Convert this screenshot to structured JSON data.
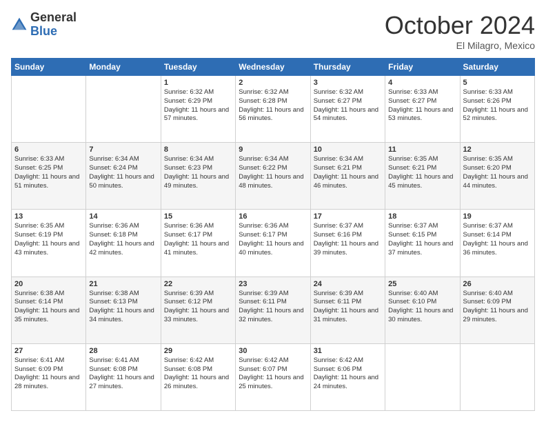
{
  "header": {
    "logo_general": "General",
    "logo_blue": "Blue",
    "month_title": "October 2024",
    "location": "El Milagro, Mexico"
  },
  "weekdays": [
    "Sunday",
    "Monday",
    "Tuesday",
    "Wednesday",
    "Thursday",
    "Friday",
    "Saturday"
  ],
  "weeks": [
    [
      {
        "day": "",
        "sunrise": "",
        "sunset": "",
        "daylight": ""
      },
      {
        "day": "",
        "sunrise": "",
        "sunset": "",
        "daylight": ""
      },
      {
        "day": "1",
        "sunrise": "Sunrise: 6:32 AM",
        "sunset": "Sunset: 6:29 PM",
        "daylight": "Daylight: 11 hours and 57 minutes."
      },
      {
        "day": "2",
        "sunrise": "Sunrise: 6:32 AM",
        "sunset": "Sunset: 6:28 PM",
        "daylight": "Daylight: 11 hours and 56 minutes."
      },
      {
        "day": "3",
        "sunrise": "Sunrise: 6:32 AM",
        "sunset": "Sunset: 6:27 PM",
        "daylight": "Daylight: 11 hours and 54 minutes."
      },
      {
        "day": "4",
        "sunrise": "Sunrise: 6:33 AM",
        "sunset": "Sunset: 6:27 PM",
        "daylight": "Daylight: 11 hours and 53 minutes."
      },
      {
        "day": "5",
        "sunrise": "Sunrise: 6:33 AM",
        "sunset": "Sunset: 6:26 PM",
        "daylight": "Daylight: 11 hours and 52 minutes."
      }
    ],
    [
      {
        "day": "6",
        "sunrise": "Sunrise: 6:33 AM",
        "sunset": "Sunset: 6:25 PM",
        "daylight": "Daylight: 11 hours and 51 minutes."
      },
      {
        "day": "7",
        "sunrise": "Sunrise: 6:34 AM",
        "sunset": "Sunset: 6:24 PM",
        "daylight": "Daylight: 11 hours and 50 minutes."
      },
      {
        "day": "8",
        "sunrise": "Sunrise: 6:34 AM",
        "sunset": "Sunset: 6:23 PM",
        "daylight": "Daylight: 11 hours and 49 minutes."
      },
      {
        "day": "9",
        "sunrise": "Sunrise: 6:34 AM",
        "sunset": "Sunset: 6:22 PM",
        "daylight": "Daylight: 11 hours and 48 minutes."
      },
      {
        "day": "10",
        "sunrise": "Sunrise: 6:34 AM",
        "sunset": "Sunset: 6:21 PM",
        "daylight": "Daylight: 11 hours and 46 minutes."
      },
      {
        "day": "11",
        "sunrise": "Sunrise: 6:35 AM",
        "sunset": "Sunset: 6:21 PM",
        "daylight": "Daylight: 11 hours and 45 minutes."
      },
      {
        "day": "12",
        "sunrise": "Sunrise: 6:35 AM",
        "sunset": "Sunset: 6:20 PM",
        "daylight": "Daylight: 11 hours and 44 minutes."
      }
    ],
    [
      {
        "day": "13",
        "sunrise": "Sunrise: 6:35 AM",
        "sunset": "Sunset: 6:19 PM",
        "daylight": "Daylight: 11 hours and 43 minutes."
      },
      {
        "day": "14",
        "sunrise": "Sunrise: 6:36 AM",
        "sunset": "Sunset: 6:18 PM",
        "daylight": "Daylight: 11 hours and 42 minutes."
      },
      {
        "day": "15",
        "sunrise": "Sunrise: 6:36 AM",
        "sunset": "Sunset: 6:17 PM",
        "daylight": "Daylight: 11 hours and 41 minutes."
      },
      {
        "day": "16",
        "sunrise": "Sunrise: 6:36 AM",
        "sunset": "Sunset: 6:17 PM",
        "daylight": "Daylight: 11 hours and 40 minutes."
      },
      {
        "day": "17",
        "sunrise": "Sunrise: 6:37 AM",
        "sunset": "Sunset: 6:16 PM",
        "daylight": "Daylight: 11 hours and 39 minutes."
      },
      {
        "day": "18",
        "sunrise": "Sunrise: 6:37 AM",
        "sunset": "Sunset: 6:15 PM",
        "daylight": "Daylight: 11 hours and 37 minutes."
      },
      {
        "day": "19",
        "sunrise": "Sunrise: 6:37 AM",
        "sunset": "Sunset: 6:14 PM",
        "daylight": "Daylight: 11 hours and 36 minutes."
      }
    ],
    [
      {
        "day": "20",
        "sunrise": "Sunrise: 6:38 AM",
        "sunset": "Sunset: 6:14 PM",
        "daylight": "Daylight: 11 hours and 35 minutes."
      },
      {
        "day": "21",
        "sunrise": "Sunrise: 6:38 AM",
        "sunset": "Sunset: 6:13 PM",
        "daylight": "Daylight: 11 hours and 34 minutes."
      },
      {
        "day": "22",
        "sunrise": "Sunrise: 6:39 AM",
        "sunset": "Sunset: 6:12 PM",
        "daylight": "Daylight: 11 hours and 33 minutes."
      },
      {
        "day": "23",
        "sunrise": "Sunrise: 6:39 AM",
        "sunset": "Sunset: 6:11 PM",
        "daylight": "Daylight: 11 hours and 32 minutes."
      },
      {
        "day": "24",
        "sunrise": "Sunrise: 6:39 AM",
        "sunset": "Sunset: 6:11 PM",
        "daylight": "Daylight: 11 hours and 31 minutes."
      },
      {
        "day": "25",
        "sunrise": "Sunrise: 6:40 AM",
        "sunset": "Sunset: 6:10 PM",
        "daylight": "Daylight: 11 hours and 30 minutes."
      },
      {
        "day": "26",
        "sunrise": "Sunrise: 6:40 AM",
        "sunset": "Sunset: 6:09 PM",
        "daylight": "Daylight: 11 hours and 29 minutes."
      }
    ],
    [
      {
        "day": "27",
        "sunrise": "Sunrise: 6:41 AM",
        "sunset": "Sunset: 6:09 PM",
        "daylight": "Daylight: 11 hours and 28 minutes."
      },
      {
        "day": "28",
        "sunrise": "Sunrise: 6:41 AM",
        "sunset": "Sunset: 6:08 PM",
        "daylight": "Daylight: 11 hours and 27 minutes."
      },
      {
        "day": "29",
        "sunrise": "Sunrise: 6:42 AM",
        "sunset": "Sunset: 6:08 PM",
        "daylight": "Daylight: 11 hours and 26 minutes."
      },
      {
        "day": "30",
        "sunrise": "Sunrise: 6:42 AM",
        "sunset": "Sunset: 6:07 PM",
        "daylight": "Daylight: 11 hours and 25 minutes."
      },
      {
        "day": "31",
        "sunrise": "Sunrise: 6:42 AM",
        "sunset": "Sunset: 6:06 PM",
        "daylight": "Daylight: 11 hours and 24 minutes."
      },
      {
        "day": "",
        "sunrise": "",
        "sunset": "",
        "daylight": ""
      },
      {
        "day": "",
        "sunrise": "",
        "sunset": "",
        "daylight": ""
      }
    ]
  ]
}
